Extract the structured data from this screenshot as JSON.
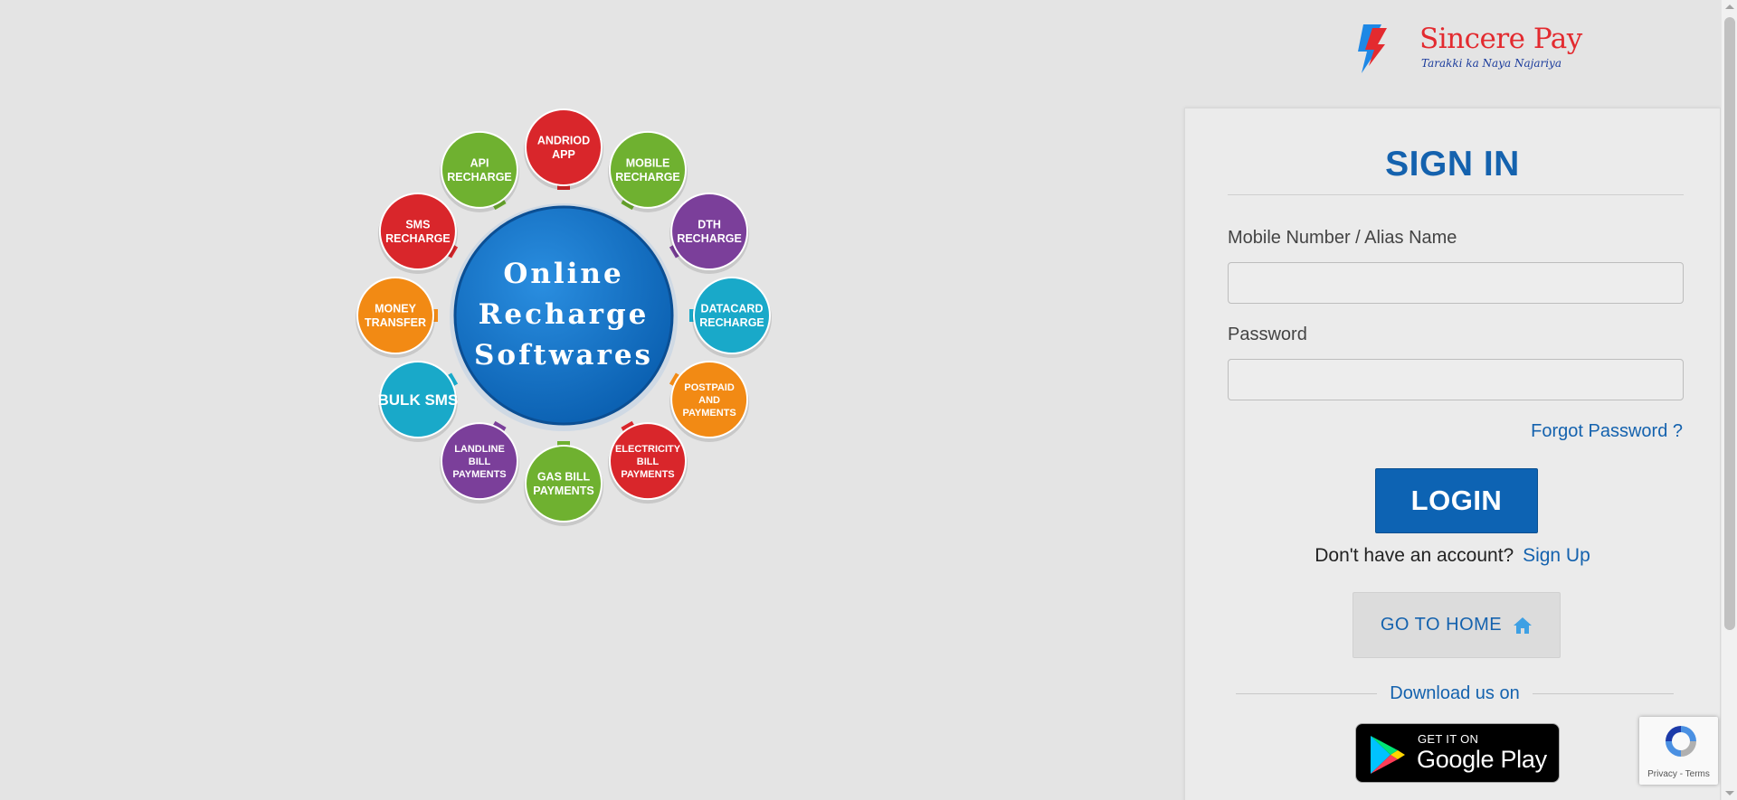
{
  "infographic": {
    "center_lines": [
      "Online",
      "Recharge",
      "Softwares"
    ],
    "bubbles": [
      {
        "id": "android-app",
        "lines": [
          "ANDRIOD",
          "APP"
        ],
        "color": "#d9262b"
      },
      {
        "id": "mobile-recharge",
        "lines": [
          "MOBILE",
          "RECHARGE"
        ],
        "color": "#6fb130"
      },
      {
        "id": "dth-recharge",
        "lines": [
          "DTH",
          "RECHARGE"
        ],
        "color": "#7b3f9a"
      },
      {
        "id": "datacard-recharge",
        "lines": [
          "DATACARD",
          "RECHARGE"
        ],
        "color": "#19a9c9"
      },
      {
        "id": "postpaid-payments",
        "lines": [
          "POSTPAID",
          "AND",
          "PAYMENTS"
        ],
        "color": "#f28a14"
      },
      {
        "id": "electricity-bill",
        "lines": [
          "ELECTRICITY",
          "BILL",
          "PAYMENTS"
        ],
        "color": "#d9262b"
      },
      {
        "id": "gas-bill",
        "lines": [
          "GAS BILL",
          "PAYMENTS"
        ],
        "color": "#6fb130"
      },
      {
        "id": "landline-bill",
        "lines": [
          "LANDLINE",
          "BILL",
          "PAYMENTS"
        ],
        "color": "#7b3f9a"
      },
      {
        "id": "bulk-sms",
        "lines": [
          "BULK SMS"
        ],
        "color": "#19a9c9"
      },
      {
        "id": "money-transfer",
        "lines": [
          "MONEY",
          "TRANSFER"
        ],
        "color": "#f28a14"
      },
      {
        "id": "sms-recharge",
        "lines": [
          "SMS",
          "RECHARGE"
        ],
        "color": "#d9262b"
      },
      {
        "id": "api-recharge",
        "lines": [
          "API",
          "RECHARGE"
        ],
        "color": "#6fb130"
      }
    ]
  },
  "brand": {
    "name": "Sincere Pay",
    "tagline": "Tarakki ka Naya Najariya",
    "colors": {
      "red": "#e32a2f",
      "blue": "#1e88e5"
    }
  },
  "signin": {
    "title": "SIGN IN",
    "username_label": "Mobile Number / Alias Name",
    "username_value": "",
    "password_label": "Password",
    "password_value": "",
    "forgot_password": "Forgot Password ?",
    "login_label": "LOGIN",
    "no_account_text": "Don't have an account?",
    "signup_link": "Sign Up",
    "go_home_label": "GO TO HOME",
    "go_home_icon": "home-icon",
    "download_text": "Download us on",
    "store_badge": {
      "top": "GET IT ON",
      "main": "Google Play"
    }
  },
  "recaptcha": {
    "text": "Privacy - Terms"
  },
  "colors": {
    "primary": "#1462ae",
    "background": "#e4e4e4",
    "panel": "#ebebeb"
  }
}
